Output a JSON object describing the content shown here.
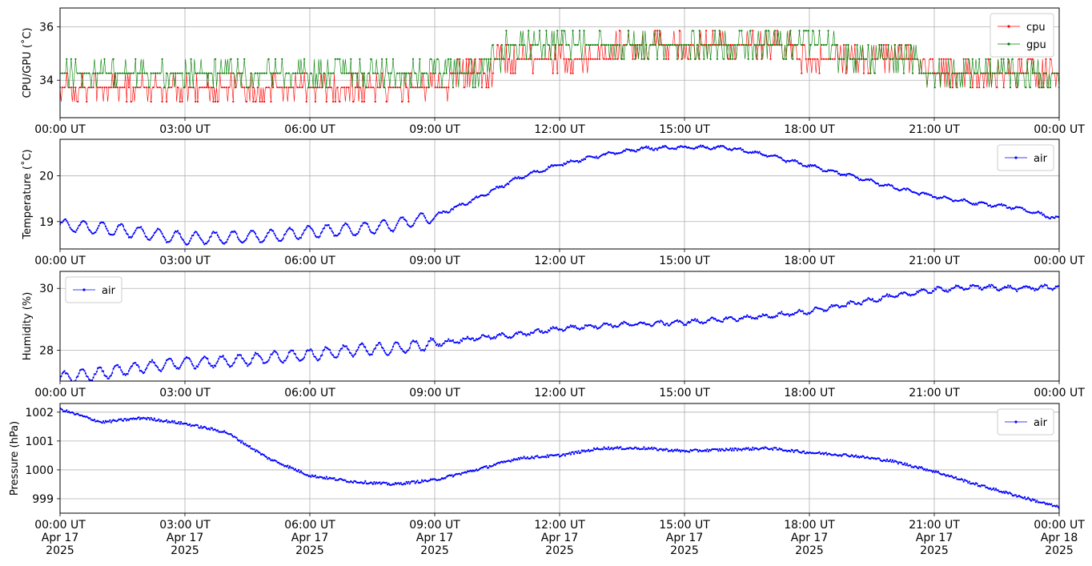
{
  "chart_data": [
    {
      "type": "line",
      "ylabel": "CPU/GPU (˚C)",
      "ylim": [
        32.6,
        36.7
      ],
      "yticks": [
        34,
        36
      ],
      "xlim": [
        "2025-04-17T00:00",
        "2025-04-18T00:00"
      ],
      "x_tick_labels": [
        "00:00 UT",
        "03:00 UT",
        "06:00 UT",
        "09:00 UT",
        "12:00 UT",
        "15:00 UT",
        "18:00 UT",
        "21:00 UT",
        "00:00 UT"
      ],
      "legend": {
        "placement": "top-right"
      },
      "grid": true,
      "series": [
        {
          "name": "cpu",
          "color": "#ff0000",
          "x": [
            "00:00",
            "01:00",
            "02:00",
            "03:00",
            "04:00",
            "05:00",
            "06:00",
            "07:00",
            "08:00",
            "09:00",
            "10:00",
            "11:00",
            "12:00",
            "13:00",
            "14:00",
            "15:00",
            "16:00",
            "17:00",
            "18:00",
            "19:00",
            "20:00",
            "21:00",
            "22:00",
            "23:00",
            "24:00"
          ],
          "y": [
            33.8,
            33.8,
            33.8,
            33.8,
            33.8,
            33.8,
            33.8,
            33.8,
            33.8,
            33.8,
            34.3,
            34.9,
            34.9,
            34.9,
            35.4,
            35.4,
            35.4,
            35.4,
            34.9,
            34.9,
            34.9,
            34.3,
            34.3,
            34.3,
            34.3
          ]
        },
        {
          "name": "gpu",
          "color": "#008000",
          "x": [
            "00:00",
            "01:00",
            "02:00",
            "03:00",
            "04:00",
            "05:00",
            "06:00",
            "07:00",
            "08:00",
            "09:00",
            "10:00",
            "11:00",
            "12:00",
            "13:00",
            "14:00",
            "15:00",
            "16:00",
            "17:00",
            "18:00",
            "19:00",
            "20:00",
            "21:00",
            "22:00",
            "23:00",
            "24:00"
          ],
          "y": [
            34.3,
            34.3,
            34.3,
            34.3,
            34.3,
            34.3,
            34.3,
            34.3,
            34.3,
            34.3,
            34.3,
            35.4,
            35.4,
            35.4,
            35.4,
            35.4,
            35.4,
            35.4,
            35.4,
            34.9,
            34.9,
            34.3,
            34.3,
            34.3,
            34.3
          ]
        }
      ]
    },
    {
      "type": "line",
      "ylabel": "Temperature (˚C)",
      "ylim": [
        18.4,
        20.8
      ],
      "yticks": [
        19,
        20
      ],
      "xlim": [
        "2025-04-17T00:00",
        "2025-04-18T00:00"
      ],
      "x_tick_labels": [
        "00:00 UT",
        "03:00 UT",
        "06:00 UT",
        "09:00 UT",
        "12:00 UT",
        "15:00 UT",
        "18:00 UT",
        "21:00 UT",
        "00:00 UT"
      ],
      "legend": {
        "placement": "top-right"
      },
      "grid": true,
      "series": [
        {
          "name": "air",
          "color": "#0000ff",
          "x": [
            "00:00",
            "01:00",
            "02:00",
            "03:00",
            "04:00",
            "05:00",
            "06:00",
            "07:00",
            "08:00",
            "09:00",
            "10:00",
            "11:00",
            "12:00",
            "13:00",
            "14:00",
            "15:00",
            "16:00",
            "17:00",
            "18:00",
            "19:00",
            "20:00",
            "21:00",
            "22:00",
            "23:00",
            "24:00"
          ],
          "y": [
            18.92,
            18.85,
            18.75,
            18.63,
            18.65,
            18.68,
            18.78,
            18.82,
            18.92,
            19.12,
            19.5,
            19.95,
            20.25,
            20.45,
            20.6,
            20.62,
            20.62,
            20.45,
            20.22,
            20.0,
            19.75,
            19.55,
            19.4,
            19.3,
            19.05
          ]
        }
      ]
    },
    {
      "type": "line",
      "ylabel": "Humidity (%)",
      "ylim": [
        27.0,
        30.55
      ],
      "yticks": [
        28,
        30
      ],
      "xlim": [
        "2025-04-17T00:00",
        "2025-04-18T00:00"
      ],
      "x_tick_labels": [
        "00:00 UT",
        "03:00 UT",
        "06:00 UT",
        "09:00 UT",
        "12:00 UT",
        "15:00 UT",
        "18:00 UT",
        "21:00 UT",
        "00:00 UT"
      ],
      "legend": {
        "placement": "top-left"
      },
      "grid": true,
      "series": [
        {
          "name": "air",
          "color": "#0000ff",
          "x": [
            "00:00",
            "01:00",
            "02:00",
            "03:00",
            "04:00",
            "05:00",
            "06:00",
            "07:00",
            "08:00",
            "09:00",
            "10:00",
            "11:00",
            "12:00",
            "13:00",
            "14:00",
            "15:00",
            "16:00",
            "17:00",
            "18:00",
            "19:00",
            "20:00",
            "21:00",
            "22:00",
            "23:00",
            "24:00"
          ],
          "y": [
            27.1,
            27.25,
            27.45,
            27.6,
            27.65,
            27.75,
            27.85,
            28.0,
            28.05,
            28.2,
            28.4,
            28.5,
            28.7,
            28.8,
            28.85,
            28.9,
            29.0,
            29.1,
            29.25,
            29.5,
            29.75,
            29.95,
            30.05,
            30.0,
            30.05
          ]
        }
      ]
    },
    {
      "type": "line",
      "ylabel": "Pressure (hPa)",
      "ylim": [
        998.5,
        1002.3
      ],
      "yticks": [
        999,
        1000,
        1001,
        1002
      ],
      "xlim": [
        "2025-04-17T00:00",
        "2025-04-18T00:00"
      ],
      "x_tick_labels": [
        "00:00 UT\nApr 17\n2025",
        "03:00 UT\nApr 17\n2025",
        "06:00 UT\nApr 17\n2025",
        "09:00 UT\nApr 17\n2025",
        "12:00 UT\nApr 17\n2025",
        "15:00 UT\nApr 17\n2025",
        "18:00 UT\nApr 17\n2025",
        "21:00 UT\nApr 17\n2025",
        "00:00 UT\nApr 18\n2025"
      ],
      "legend": {
        "placement": "top-right"
      },
      "grid": true,
      "series": [
        {
          "name": "air",
          "color": "#0000ff",
          "x": [
            "00:00",
            "01:00",
            "02:00",
            "03:00",
            "04:00",
            "05:00",
            "06:00",
            "07:00",
            "08:00",
            "09:00",
            "10:00",
            "11:00",
            "12:00",
            "13:00",
            "14:00",
            "15:00",
            "16:00",
            "17:00",
            "18:00",
            "19:00",
            "20:00",
            "21:00",
            "22:00",
            "23:00",
            "24:00"
          ],
          "y": [
            1002.1,
            1001.65,
            1001.8,
            1001.6,
            1001.3,
            1000.4,
            999.8,
            999.6,
            999.5,
            999.65,
            1000.0,
            1000.4,
            1000.5,
            1000.75,
            1000.75,
            1000.65,
            1000.7,
            1000.75,
            1000.6,
            1000.5,
            1000.3,
            999.95,
            999.5,
            999.1,
            998.7
          ]
        }
      ]
    }
  ]
}
